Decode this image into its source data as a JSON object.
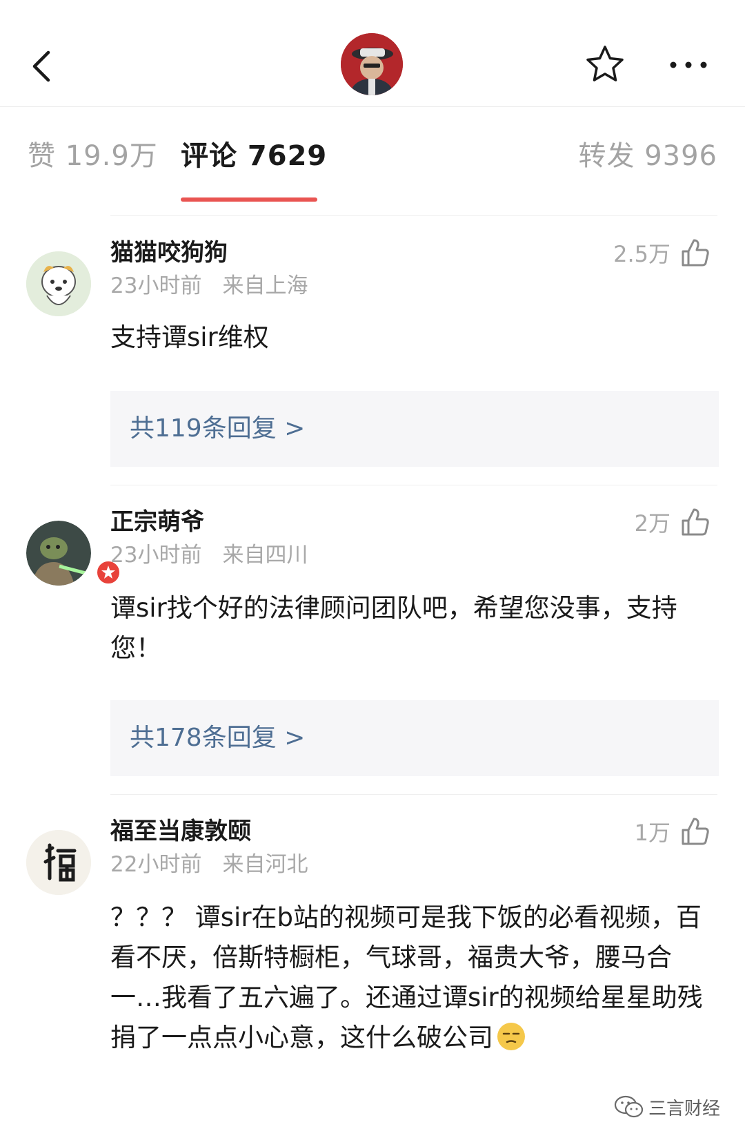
{
  "tabs": {
    "like": "赞 19.9万",
    "comment": "评论 7629",
    "forward": "转发 9396"
  },
  "comments": [
    {
      "name": "猫猫咬狗狗",
      "time": "23小时前",
      "location": "来自上海",
      "likes": "2.5万",
      "text": "支持谭sir维权",
      "replies": "共119条回复 >"
    },
    {
      "name": "正宗萌爷",
      "time": "23小时前",
      "location": "来自四川",
      "likes": "2万",
      "text": "谭sir找个好的法律顾问团队吧，希望您没事，支持您！",
      "replies": "共178条回复 >"
    },
    {
      "name": "福至当康敦颐",
      "time": "22小时前",
      "location": "来自河北",
      "likes": "1万",
      "text": "？？？ 谭sir在b站的视频可是我下饭的必看视频，百看不厌，倍斯特橱柜，气球哥，福贵大爷，腰马合一…我看了五六遍了。还通过谭sir的视频给星星助残捐了一点点小心意，这什么破公司"
    }
  ],
  "watermark": "三言财经",
  "colors": {
    "accent": "#e95451",
    "reply_link": "#4e6e93",
    "muted_text": "#a8a8a8",
    "reply_bg": "#f6f6f8"
  },
  "icons": [
    "back-arrow-icon",
    "star-icon",
    "more-icon",
    "thumb-up-icon",
    "vip-badge-icon",
    "wechat-icon",
    "emoji-icon"
  ]
}
